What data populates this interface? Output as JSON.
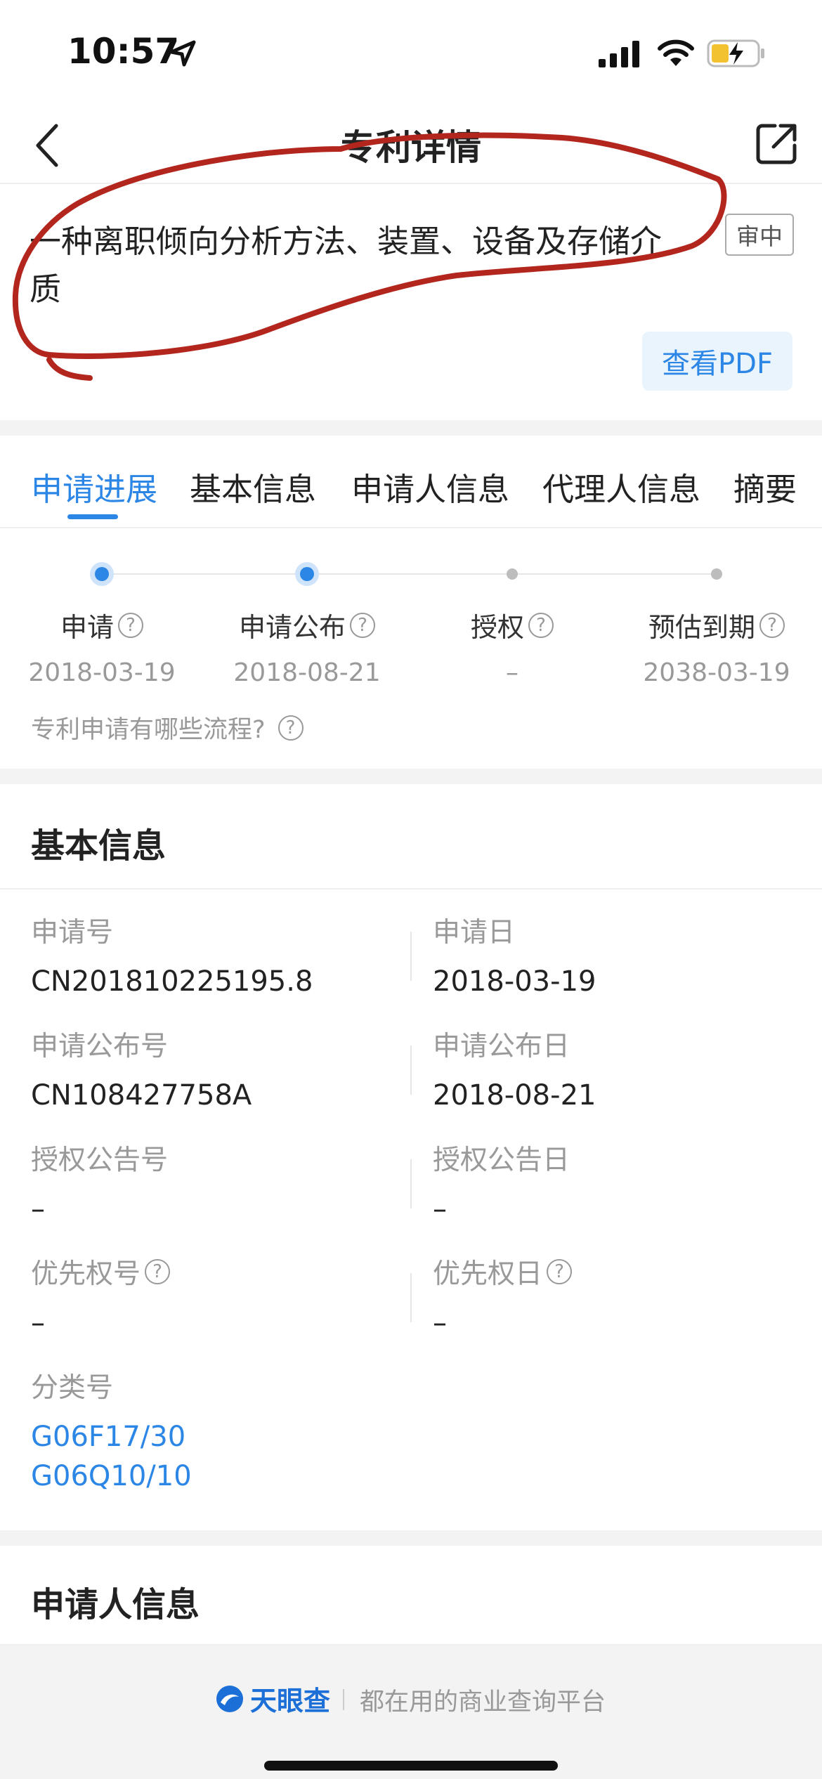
{
  "status_bar": {
    "time": "10:57"
  },
  "nav": {
    "title": "专利详情"
  },
  "patent": {
    "title": "一种离职倾向分析方法、装置、设备及存储介质",
    "status": "审中",
    "pdf_label": "查看PDF"
  },
  "tabs": [
    {
      "label": "申请进展"
    },
    {
      "label": "基本信息"
    },
    {
      "label": "申请人信息"
    },
    {
      "label": "代理人信息"
    },
    {
      "label": "摘要"
    }
  ],
  "progress": {
    "steps": [
      {
        "label": "申请",
        "date": "2018-03-19"
      },
      {
        "label": "申请公布",
        "date": "2018-08-21"
      },
      {
        "label": "授权",
        "date": "–"
      },
      {
        "label": "预估到期",
        "date": "2038-03-19"
      }
    ],
    "help_link": "专利申请有哪些流程?",
    "help_icon": "?"
  },
  "basic_info": {
    "title": "基本信息",
    "app_no_label": "申请号",
    "app_no": "CN201810225195.8",
    "app_date_label": "申请日",
    "app_date": "2018-03-19",
    "pub_no_label": "申请公布号",
    "pub_no": "CN108427758A",
    "pub_date_label": "申请公布日",
    "pub_date": "2018-08-21",
    "grant_no_label": "授权公告号",
    "grant_no": "–",
    "grant_date_label": "授权公告日",
    "grant_date": "–",
    "priority_no_label": "优先权号",
    "priority_no": "–",
    "priority_date_label": "优先权日",
    "priority_date": "–",
    "class_label": "分类号",
    "class_1": "G06F17/30",
    "class_2": "G06Q10/10"
  },
  "applicant_section": {
    "title": "申请人信息"
  },
  "footer": {
    "brand": "天眼查",
    "slogan": "都在用的商业查询平台"
  },
  "colors": {
    "accent": "#2b86e6",
    "annotation": "#b3261e"
  }
}
